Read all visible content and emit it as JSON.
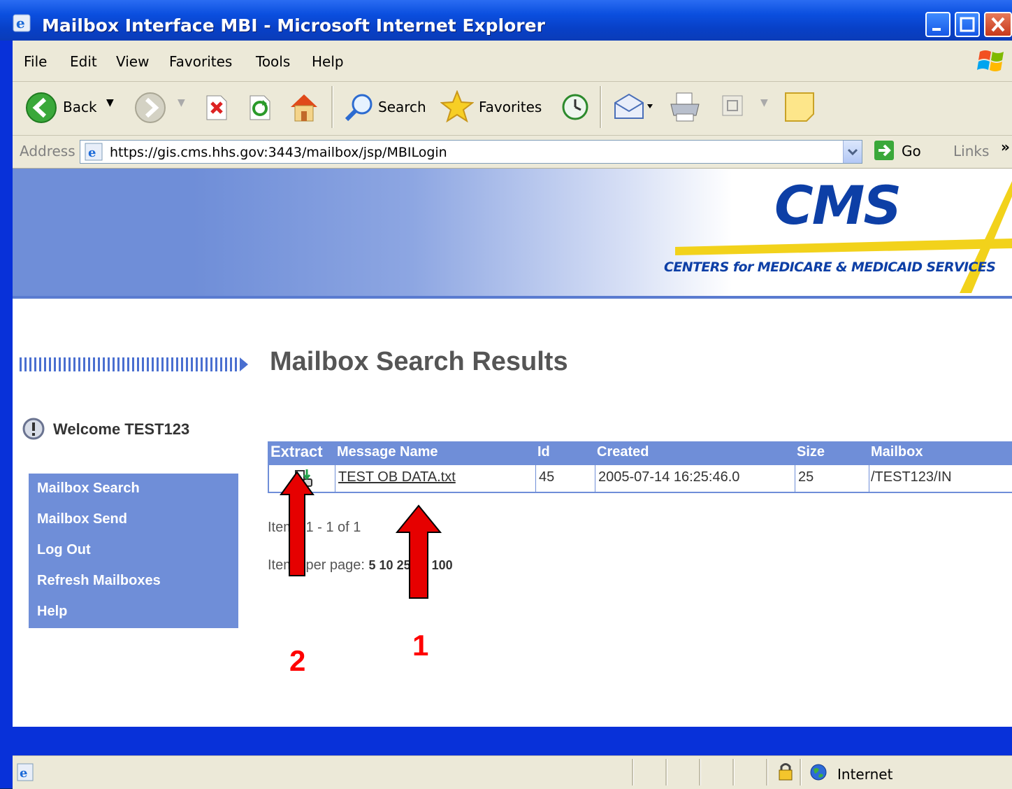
{
  "window": {
    "title": "Mailbox Interface MBI - Microsoft Internet Explorer"
  },
  "menu": {
    "items": [
      "File",
      "Edit",
      "View",
      "Favorites",
      "Tools",
      "Help"
    ]
  },
  "toolbar": {
    "back_label": "Back",
    "search_label": "Search",
    "favorites_label": "Favorites"
  },
  "address": {
    "label": "Address",
    "url": "https://gis.cms.hhs.gov:3443/mailbox/jsp/MBILogin",
    "go_label": "Go",
    "links_label": "Links",
    "chevron": "»"
  },
  "banner": {
    "logo_text": "CMS",
    "subtitle": "CENTERS for MEDICARE & MEDICAID SERVICES"
  },
  "page": {
    "heading": "Mailbox Search Results",
    "welcome": "Welcome TEST123"
  },
  "nav": {
    "items": [
      "Mailbox Search",
      "Mailbox Send",
      "Log Out",
      "Refresh Mailboxes",
      "Help"
    ]
  },
  "results": {
    "columns": [
      "Extract",
      "Message Name",
      "Id",
      "Created",
      "Size",
      "Mailbox"
    ],
    "rows": [
      {
        "message_name": "TEST OB DATA.txt",
        "id": "45",
        "created": "2005-07-14 16:25:46.0",
        "size": "25",
        "mailbox": "/TEST123/IN"
      }
    ],
    "items_summary": "Items 1 - 1 of 1",
    "per_page_label": "Items per page:",
    "per_page_options": "5 10 25 50 100"
  },
  "annotations": {
    "label_1": "1",
    "label_2": "2"
  },
  "status": {
    "zone": "Internet"
  },
  "colors": {
    "nav_blue": "#6f8ed8",
    "annotation_red": "#ff0000",
    "cms_blue": "#0d3fa6",
    "cms_yellow": "#f2d21b"
  }
}
